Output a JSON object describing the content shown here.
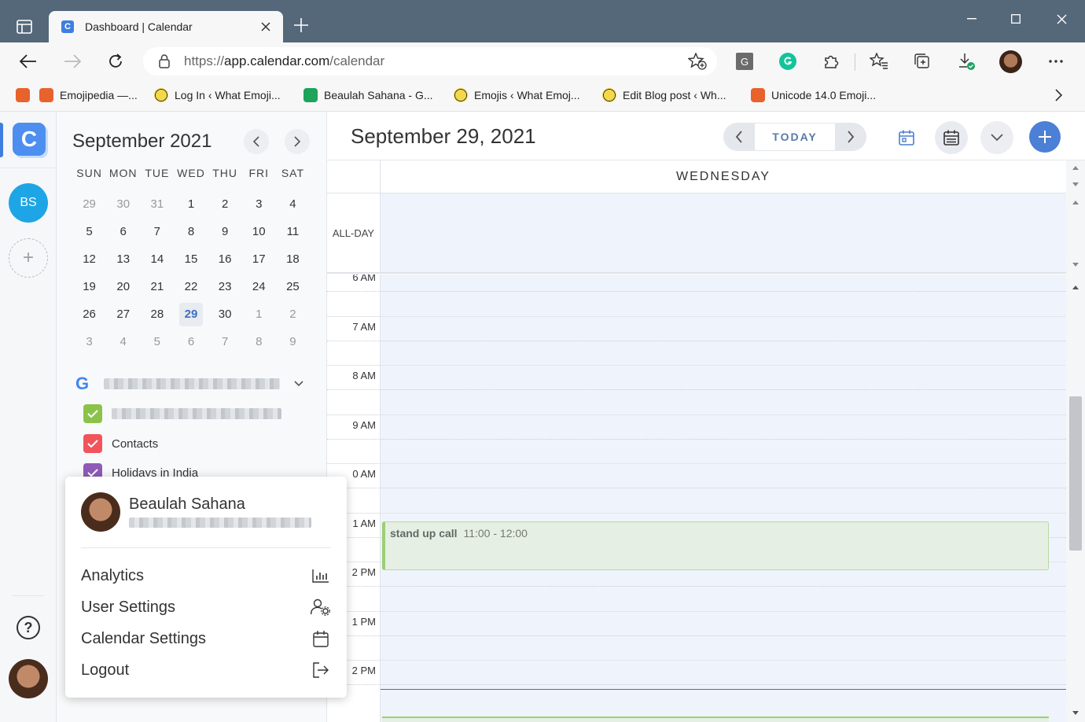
{
  "browser": {
    "tab_title": "Dashboard | Calendar",
    "tab_favicon_letter": "C",
    "url_prefix": "https://",
    "url_host": "app.calendar.com",
    "url_path": "/calendar",
    "extension_g_label": "G",
    "bookmarks": [
      {
        "label": "Emojipedia —...",
        "icon": "orange"
      },
      {
        "label": "Log In ‹ What Emoji...",
        "icon": "emoji"
      },
      {
        "label": "Beaulah Sahana - G...",
        "icon": "green"
      },
      {
        "label": "Emojis ‹ What Emoj...",
        "icon": "emoji"
      },
      {
        "label": "Edit Blog post ‹ Wh...",
        "icon": "emoji"
      },
      {
        "label": "Unicode 14.0 Emoji...",
        "icon": "orange"
      }
    ]
  },
  "rail": {
    "logo_letter": "C",
    "account_initials": "BS",
    "add_label": "+",
    "help_label": "?"
  },
  "mini_calendar": {
    "title": "September 2021",
    "weekdays": [
      "SUN",
      "MON",
      "TUE",
      "WED",
      "THU",
      "FRI",
      "SAT"
    ],
    "weeks": [
      [
        "29",
        "30",
        "31",
        "1",
        "2",
        "3",
        "4"
      ],
      [
        "5",
        "6",
        "7",
        "8",
        "9",
        "10",
        "11"
      ],
      [
        "12",
        "13",
        "14",
        "15",
        "16",
        "17",
        "18"
      ],
      [
        "19",
        "20",
        "21",
        "22",
        "23",
        "24",
        "25"
      ],
      [
        "26",
        "27",
        "28",
        "29",
        "30",
        "1",
        "2"
      ],
      [
        "3",
        "4",
        "5",
        "6",
        "7",
        "8",
        "9"
      ]
    ],
    "selected_day": "29"
  },
  "calendars": {
    "google_letter": "G",
    "items": [
      {
        "label": "",
        "color": "#8bc34a",
        "checked": true
      },
      {
        "label": "Contacts",
        "color": "#f2545b",
        "checked": true
      },
      {
        "label": "Holidays in India",
        "color": "#8e5bb7",
        "checked": true
      }
    ]
  },
  "main": {
    "date_title": "September 29, 2021",
    "today_label": "TODAY",
    "day_header": "WEDNESDAY",
    "allday_label": "ALL-DAY",
    "hours": [
      "6 AM",
      "7 AM",
      "8 AM",
      "9 AM",
      "0 AM",
      "1 AM",
      "2 PM",
      "1 PM",
      "2 PM"
    ],
    "event": {
      "title": "stand up call",
      "time": "11:00 - 12:00",
      "color": "#9ccf75"
    },
    "add_button": "+",
    "accent": "#4c7fd6"
  },
  "profile_menu": {
    "name": "Beaulah Sahana",
    "items": [
      {
        "label": "Analytics",
        "icon": "bar-chart-icon"
      },
      {
        "label": "User Settings",
        "icon": "user-settings-icon"
      },
      {
        "label": "Calendar Settings",
        "icon": "calendar-icon"
      },
      {
        "label": "Logout",
        "icon": "logout-icon"
      }
    ]
  }
}
